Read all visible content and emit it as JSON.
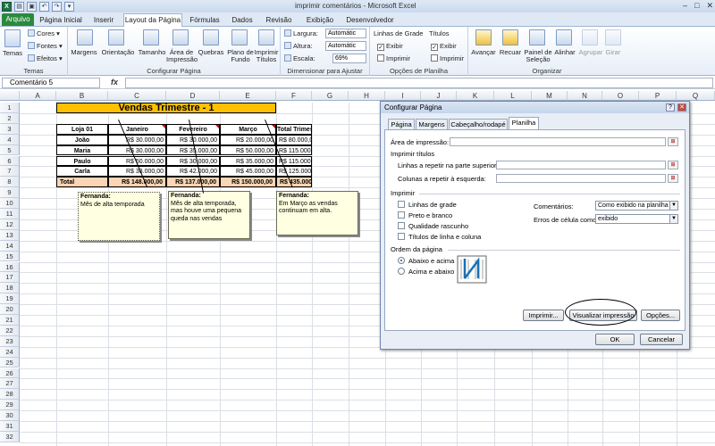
{
  "window": {
    "title": "imprimir comentários - Microsoft Excel",
    "min": "–",
    "max": "□",
    "close": "✕"
  },
  "tabs": [
    "Arquivo",
    "Página Inicial",
    "Inserir",
    "Layout da Página",
    "Fórmulas",
    "Dados",
    "Revisão",
    "Exibição",
    "Desenvolvedor"
  ],
  "ribbon": {
    "temas": {
      "label": "Temas",
      "btn": "Temas",
      "cores": "Cores",
      "fontes": "Fontes",
      "efeitos": "Efeitos"
    },
    "config": {
      "label": "Configurar Página",
      "margens": "Margens",
      "orientacao": "Orientação",
      "tamanho": "Tamanho",
      "area1": "Área de",
      "area2": "Impressão",
      "quebras": "Quebras",
      "plano1": "Plano de",
      "plano2": "Fundo",
      "imprimir1": "Imprimir",
      "imprimir2": "Títulos"
    },
    "dimensionar": {
      "label": "Dimensionar para Ajustar",
      "largura": "Largura:",
      "largura_val": "Automátic",
      "altura": "Altura:",
      "altura_val": "Automátic",
      "escala": "Escala:",
      "escala_val": "69%"
    },
    "opcoes": {
      "label": "Opções de Planilha",
      "linhas": "Linhas de Grade",
      "titulos": "Títulos",
      "exibir": "Exibir",
      "imprimir": "Imprimir"
    },
    "organizar": {
      "label": "Organizar",
      "avancar": "Avançar",
      "recuar": "Recuar",
      "painel1": "Painel de",
      "painel2": "Seleção",
      "alinhar": "Alinhar",
      "agrupar": "Agrupar",
      "girar": "Girar"
    }
  },
  "formula_bar": {
    "name_box": "Comentário 5",
    "fx": "fx",
    "value": ""
  },
  "columns": [
    "A",
    "B",
    "C",
    "D",
    "E",
    "F",
    "G",
    "H",
    "I",
    "J",
    "K",
    "L",
    "M",
    "N",
    "O",
    "P",
    "Q"
  ],
  "rows": [
    "1",
    "2",
    "3",
    "4",
    "5",
    "6",
    "7",
    "8",
    "9",
    "10",
    "11",
    "12",
    "13",
    "14",
    "15",
    "16",
    "17",
    "18",
    "19",
    "20",
    "21",
    "22",
    "23",
    "24",
    "25",
    "26",
    "27",
    "28",
    "29",
    "30",
    "31",
    "32"
  ],
  "table": {
    "title": "Vendas Trimestre - 1",
    "headers": [
      "Loja 01",
      "Janeiro",
      "Fevereiro",
      "Março",
      "Total Trimestre"
    ],
    "rows": [
      [
        "João",
        "R$ 30.000,00",
        "R$ 30.000,00",
        "R$ 20.000,00",
        "R$ 80.000,00"
      ],
      [
        "Maria",
        "R$ 30.000,00",
        "R$ 35.000,00",
        "R$ 50.000,00",
        "R$ 115.000,00"
      ],
      [
        "Paulo",
        "R$ 50.000,00",
        "R$ 30.000,00",
        "R$ 35.000,00",
        "R$ 115.000,00"
      ],
      [
        "Carla",
        "R$ 38.000,00",
        "R$ 42.000,00",
        "R$ 45.000,00",
        "R$ 125.000,00"
      ]
    ],
    "total": [
      "Total",
      "R$ 148.000,00",
      "R$ 137.000,00",
      "R$ 150.000,00",
      "R$ 435.000,00"
    ]
  },
  "comments": [
    {
      "author": "Fernanda:",
      "text": "Mês de alta temporada"
    },
    {
      "author": "Fernanda:",
      "text": "Mês de alta temporada, mas houve uma pequena queda nas vendas"
    },
    {
      "author": "Fernanda:",
      "text": "Em Março as vendas continuam em alta."
    }
  ],
  "colors": {
    "title_fill": "#ffc000",
    "total_fill": "#fcd5b4",
    "note_fill": "#ffffe1",
    "file_tab": "#2a8a3c"
  },
  "dialog": {
    "title": "Configurar Página",
    "help": "?",
    "close": "✕",
    "tabs": [
      "Página",
      "Margens",
      "Cabeçalho/rodapé",
      "Planilha"
    ],
    "area_impressao": "Área de impressão:",
    "imprimir_titulos": "Imprimir títulos",
    "linhas_repetir": "Linhas a repetir na parte superior:",
    "colunas_repetir": "Colunas a repetir à esquerda:",
    "imprimir": "Imprimir",
    "checks": [
      "Linhas de grade",
      "Preto e branco",
      "Qualidade rascunho",
      "Títulos de linha e coluna"
    ],
    "comentarios_label": "Comentários:",
    "comentarios_val": "Como exibido na planilha",
    "erros_label": "Erros de célula como:",
    "erros_val": "exibido",
    "ordem": "Ordem da página",
    "abaixo": "Abaixo e acima",
    "acima": "Acima e abaixo",
    "btn_imprimir": "Imprimir...",
    "btn_visualizar": "Visualizar impressão",
    "btn_opcoes": "Opções...",
    "btn_ok": "OK",
    "btn_cancelar": "Cancelar"
  }
}
